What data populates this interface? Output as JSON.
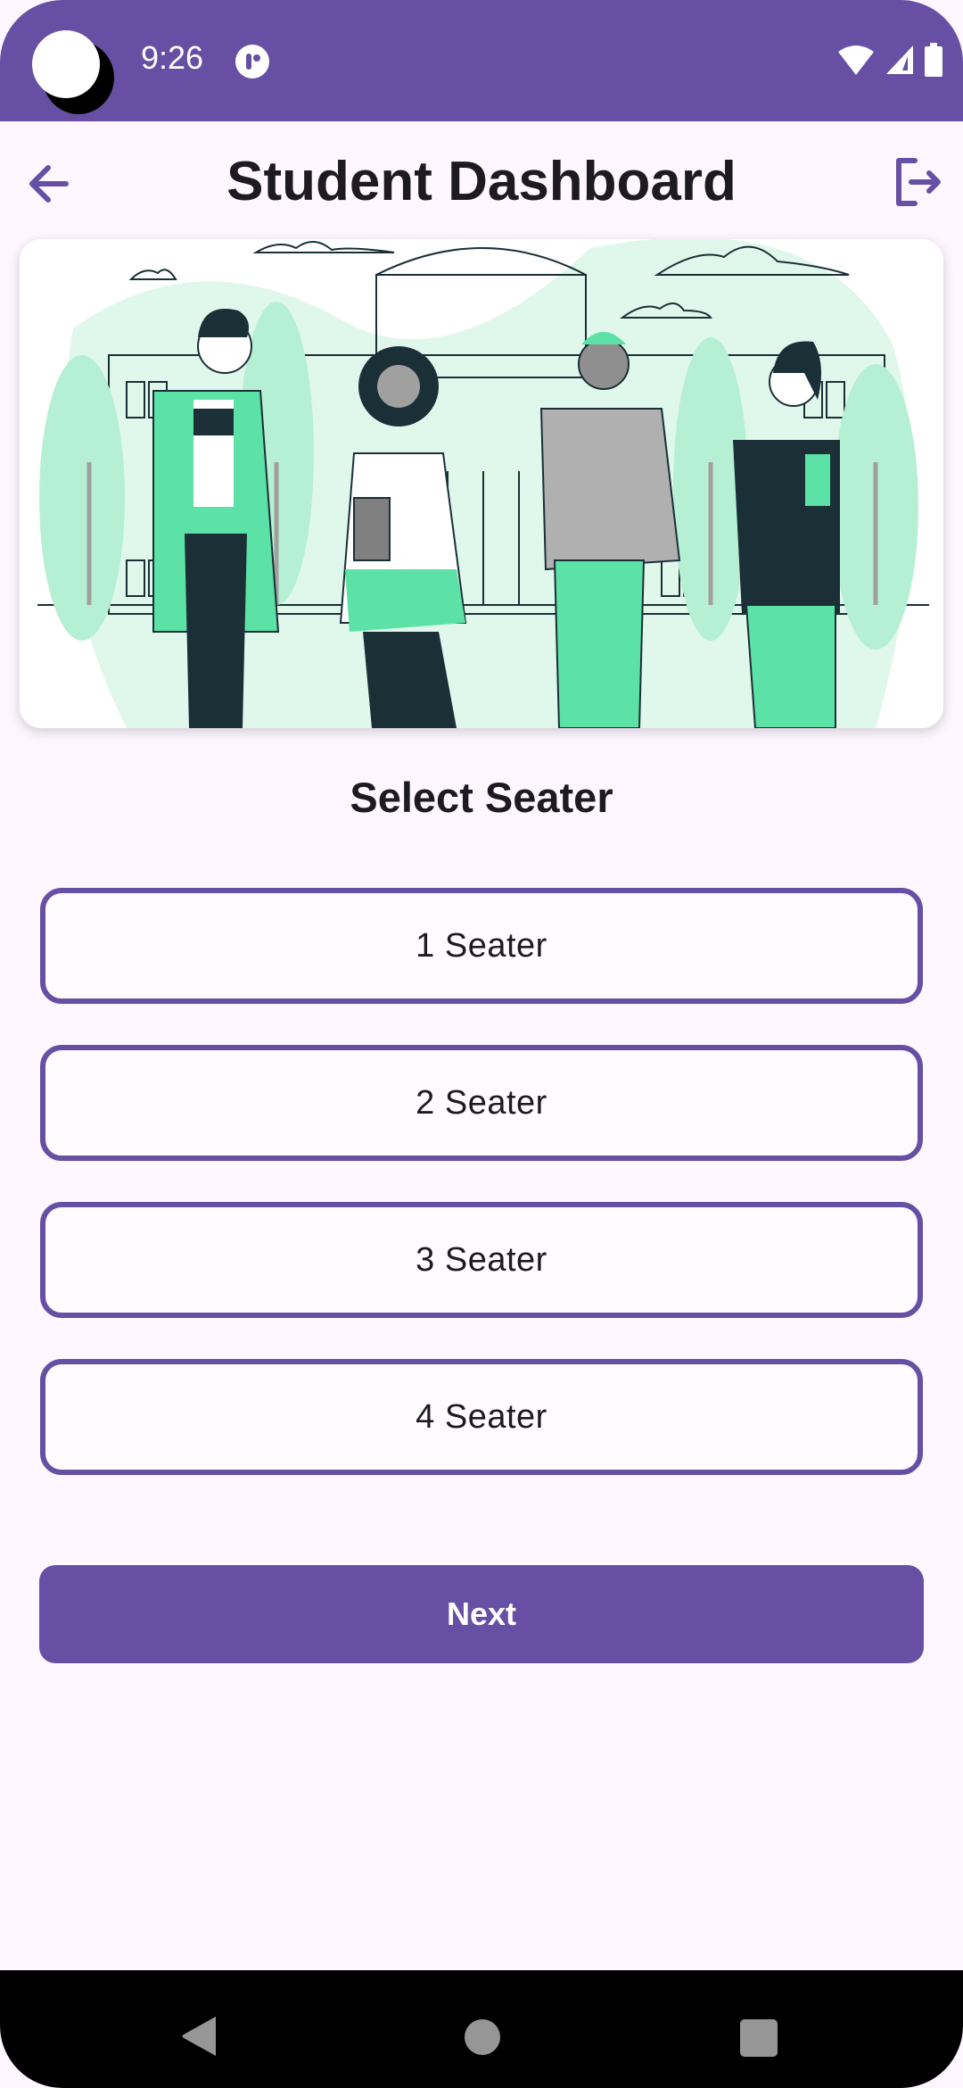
{
  "status_bar": {
    "time": "9:26",
    "icons": [
      "camera-cutout-icon",
      "notification-icon",
      "wifi-icon",
      "signal-icon",
      "battery-icon"
    ]
  },
  "top_bar": {
    "title": "Student Dashboard",
    "back_icon": "arrow-left-icon",
    "logout_icon": "logout-icon"
  },
  "hero": {
    "illustration": "students-in-front-of-campus-illustration"
  },
  "main": {
    "section_title": "Select Seater",
    "options": [
      {
        "label": "1 Seater"
      },
      {
        "label": "2 Seater"
      },
      {
        "label": "3 Seater"
      },
      {
        "label": "4 Seater"
      }
    ],
    "next_label": "Next"
  },
  "nav_bar": {
    "icons": [
      "nav-back-icon",
      "nav-home-icon",
      "nav-recents-icon"
    ]
  },
  "colors": {
    "primary": "#6750a4",
    "background": "#fef7ff",
    "accent_green": "#5ce1a6",
    "text": "#1d1b20"
  }
}
